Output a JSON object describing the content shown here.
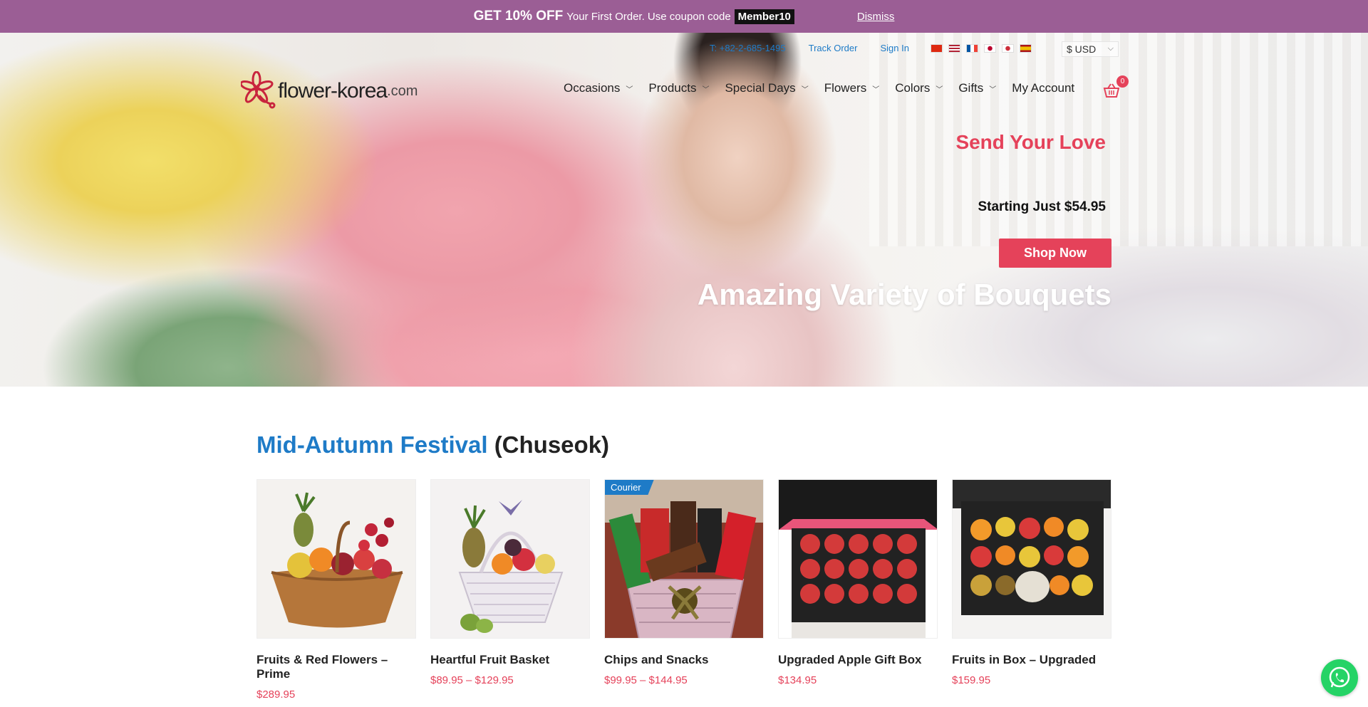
{
  "promo": {
    "headline": "GET 10% OFF",
    "text": "Your First Order. Use coupon code",
    "coupon": "Member10",
    "dismiss": "Dismiss"
  },
  "util": {
    "phone": "T: +82-2-685-1495",
    "track": "Track Order",
    "signin": "Sign In",
    "flags": [
      "cn-flag-icon",
      "us-flag-icon",
      "fr-flag-icon",
      "jp-flag-icon",
      "kr-flag-icon",
      "es-flag-icon"
    ],
    "currency": "$ USD"
  },
  "logo": {
    "word": "flower-korea",
    "tld": ".com"
  },
  "nav": {
    "items": [
      {
        "label": "Occasions",
        "dropdown": true
      },
      {
        "label": "Products",
        "dropdown": true
      },
      {
        "label": "Special Days",
        "dropdown": true
      },
      {
        "label": "Flowers",
        "dropdown": true
      },
      {
        "label": "Colors",
        "dropdown": true
      },
      {
        "label": "Gifts",
        "dropdown": true
      },
      {
        "label": "My Account",
        "dropdown": false
      }
    ],
    "cart_count": "0"
  },
  "hero": {
    "title": "Send Your Love",
    "price": "Starting Just $54.95",
    "button": "Shop Now",
    "subtitle": "Amazing Variety of Bouquets"
  },
  "section": {
    "title_highlight": "Mid-Autumn Festival",
    "title_rest": "(Chuseok)"
  },
  "products": [
    {
      "name": "Fruits & Red Flowers – Prime",
      "price": "$289.95",
      "badge": ""
    },
    {
      "name": "Heartful Fruit Basket",
      "price": "$89.95 – $129.95",
      "badge": ""
    },
    {
      "name": "Chips and Snacks",
      "price": "$99.95 – $144.95",
      "badge": "Courier"
    },
    {
      "name": "Upgraded Apple Gift Box",
      "price": "$134.95",
      "badge": ""
    },
    {
      "name": "Fruits in Box – Upgraded",
      "price": "$159.95",
      "badge": ""
    }
  ],
  "colors": {
    "promo_bg": "#9b5e95",
    "accent": "#e5425a",
    "link_blue": "#1e7bc7"
  }
}
